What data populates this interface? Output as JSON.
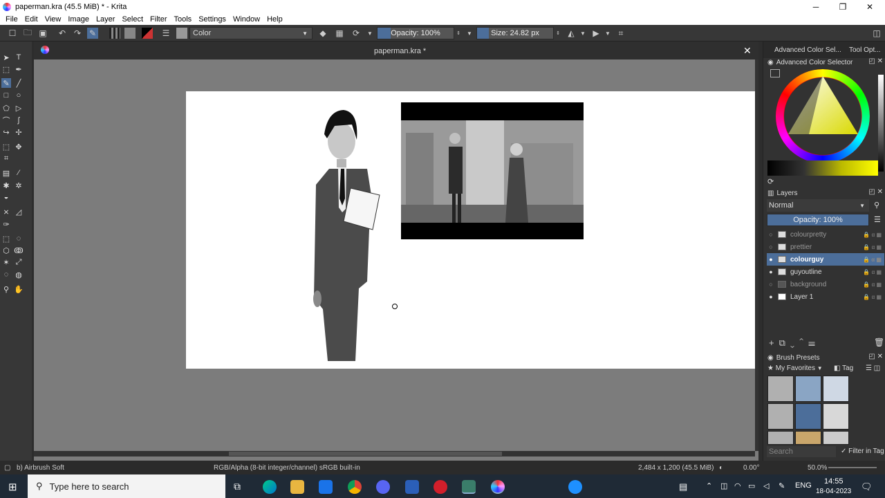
{
  "window": {
    "title": "paperman.kra (45.5 MiB)  * - Krita",
    "minimize": "─",
    "maximize": "❐",
    "close": "✕"
  },
  "menu": [
    "File",
    "Edit",
    "View",
    "Image",
    "Layer",
    "Select",
    "Filter",
    "Tools",
    "Settings",
    "Window",
    "Help"
  ],
  "toolbar": {
    "blend_mode": "Color",
    "opacity": "Opacity: 100%",
    "opacity_fraction": 0.17,
    "size": "Size: 24.82 px",
    "size_fraction": 0.15
  },
  "document": {
    "tab_title": "paperman.kra *",
    "close": "✕"
  },
  "dock": {
    "tab1": "Advanced Color Sel...",
    "tab2": "Tool Opt...",
    "color_selector_title": "Advanced Color Selector",
    "layers_title": "Layers",
    "layer_blend_mode": "Normal",
    "layer_opacity": "Opacity:  100%",
    "layers": [
      {
        "name": "colourpretty",
        "visible": false,
        "selected": false
      },
      {
        "name": "prettier",
        "visible": false,
        "selected": false
      },
      {
        "name": "colourguy",
        "visible": true,
        "selected": true
      },
      {
        "name": "guyoutline",
        "visible": true,
        "selected": false
      },
      {
        "name": "background",
        "visible": false,
        "selected": false
      },
      {
        "name": "Layer 1",
        "visible": true,
        "selected": false
      }
    ],
    "brush_presets_title": "Brush Presets",
    "presets_filter": "My Favorites",
    "presets_tag": "Tag",
    "presets_search_placeholder": "Search",
    "filter_in_tag": "Filter in Tag"
  },
  "status": {
    "brush": "b) Airbrush Soft",
    "colorspace": "RGB/Alpha (8-bit integer/channel)  sRGB built-in",
    "dimensions": "2,484 x 1,200 (45.5 MiB)",
    "rotation": "0.00°",
    "zoom": "50.0%"
  },
  "taskbar": {
    "search_placeholder": "Type here to search",
    "lang": "ENG",
    "time": "14:55",
    "date": "18-04-2023"
  },
  "colors": {
    "accent": "#4c6e9a",
    "panel": "#323232",
    "canvas_bg": "#7c7c7c"
  }
}
